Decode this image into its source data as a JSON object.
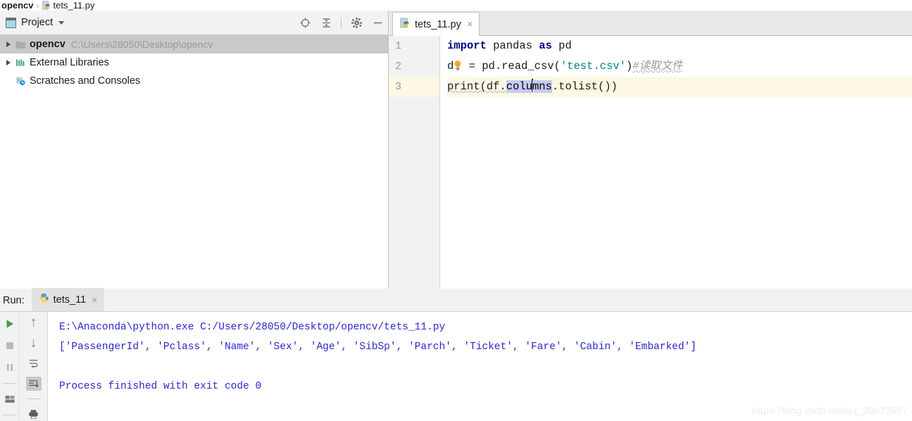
{
  "breadcrumb": {
    "project": "opencv",
    "separator": "›",
    "file": "tets_11.py",
    "file_icon": "python-file-icon"
  },
  "project_panel": {
    "title": "Project",
    "window_icon": "project-window-icon",
    "dropdown_icon": "chevron-down-icon",
    "toolbar": [
      {
        "name": "locate-icon",
        "tooltip": "Select Opened File"
      },
      {
        "name": "collapse-all-icon",
        "tooltip": "Collapse All"
      },
      {
        "name": "gear-icon",
        "tooltip": "Settings"
      },
      {
        "name": "minimize-icon",
        "tooltip": "Hide"
      }
    ],
    "tree": [
      {
        "label": "opencv",
        "path": "C:\\Users\\28050\\Desktop\\opencv",
        "icon": "folder-icon",
        "expander": "chevron-right-icon",
        "bold": true,
        "selected": true
      },
      {
        "label": "External Libraries",
        "path": "",
        "icon": "libraries-icon",
        "expander": "chevron-right-icon",
        "bold": false,
        "selected": false
      },
      {
        "label": "Scratches and Consoles",
        "path": "",
        "icon": "scratches-icon",
        "expander": "",
        "bold": false,
        "selected": false
      }
    ]
  },
  "editor": {
    "tab": {
      "label": "tets_11.py",
      "icon": "python-file-icon",
      "close": "×"
    },
    "gutter_lines": [
      "1",
      "2",
      "3"
    ],
    "current_line": 3,
    "code": {
      "line1": {
        "kw_import": "import",
        "module": " pandas ",
        "kw_as": "as",
        "alias": " pd"
      },
      "line2": {
        "var_prefix": "d",
        "var_hidden_letter": "f",
        "bulb_icon": "lightbulb-intention-icon",
        "assign": " = pd.read_csv(",
        "string": "'test.csv'",
        "close": ")",
        "comment": "#读取文件"
      },
      "line3": {
        "call": "print(df.",
        "selected_a": "colu",
        "selected_b": "mns",
        "tail": ".tolist())"
      }
    }
  },
  "run_panel": {
    "label": "Run:",
    "tab": {
      "label": "tets_11",
      "icon": "python-icon",
      "close": "×"
    },
    "toolbar_left": [
      {
        "name": "run-icon",
        "active": false
      },
      {
        "name": "stop-icon",
        "active": false
      },
      {
        "name": "pause-icon",
        "active": false
      },
      {
        "name": "restore-layout-icon",
        "active": false
      }
    ],
    "toolbar_right": [
      {
        "name": "arrow-up-icon",
        "active": false
      },
      {
        "name": "arrow-down-icon",
        "active": false
      },
      {
        "name": "soft-wrap-icon",
        "active": false
      },
      {
        "name": "scroll-to-end-icon",
        "active": true
      },
      {
        "name": "print-icon",
        "active": false
      }
    ],
    "console": {
      "line1": "E:\\Anaconda\\python.exe C:/Users/28050/Desktop/opencv/tets_11.py",
      "line2": "['PassengerId', 'Pclass', 'Name', 'Sex', 'Age', 'SibSp', 'Parch', 'Ticket', 'Fare', 'Cabin', 'Embarked']",
      "line3": "",
      "line4": "Process finished with exit code 0"
    }
  },
  "watermark": "https://blog.csdn.net/qq_39072607",
  "colors": {
    "keyword": "#000080",
    "string": "#008080",
    "comment": "#9a9a9a",
    "console_text": "#2a2acc",
    "selection": "#c8caf5",
    "caret_row": "#fdf8e3",
    "tree_selection": "#c9c9c9"
  }
}
